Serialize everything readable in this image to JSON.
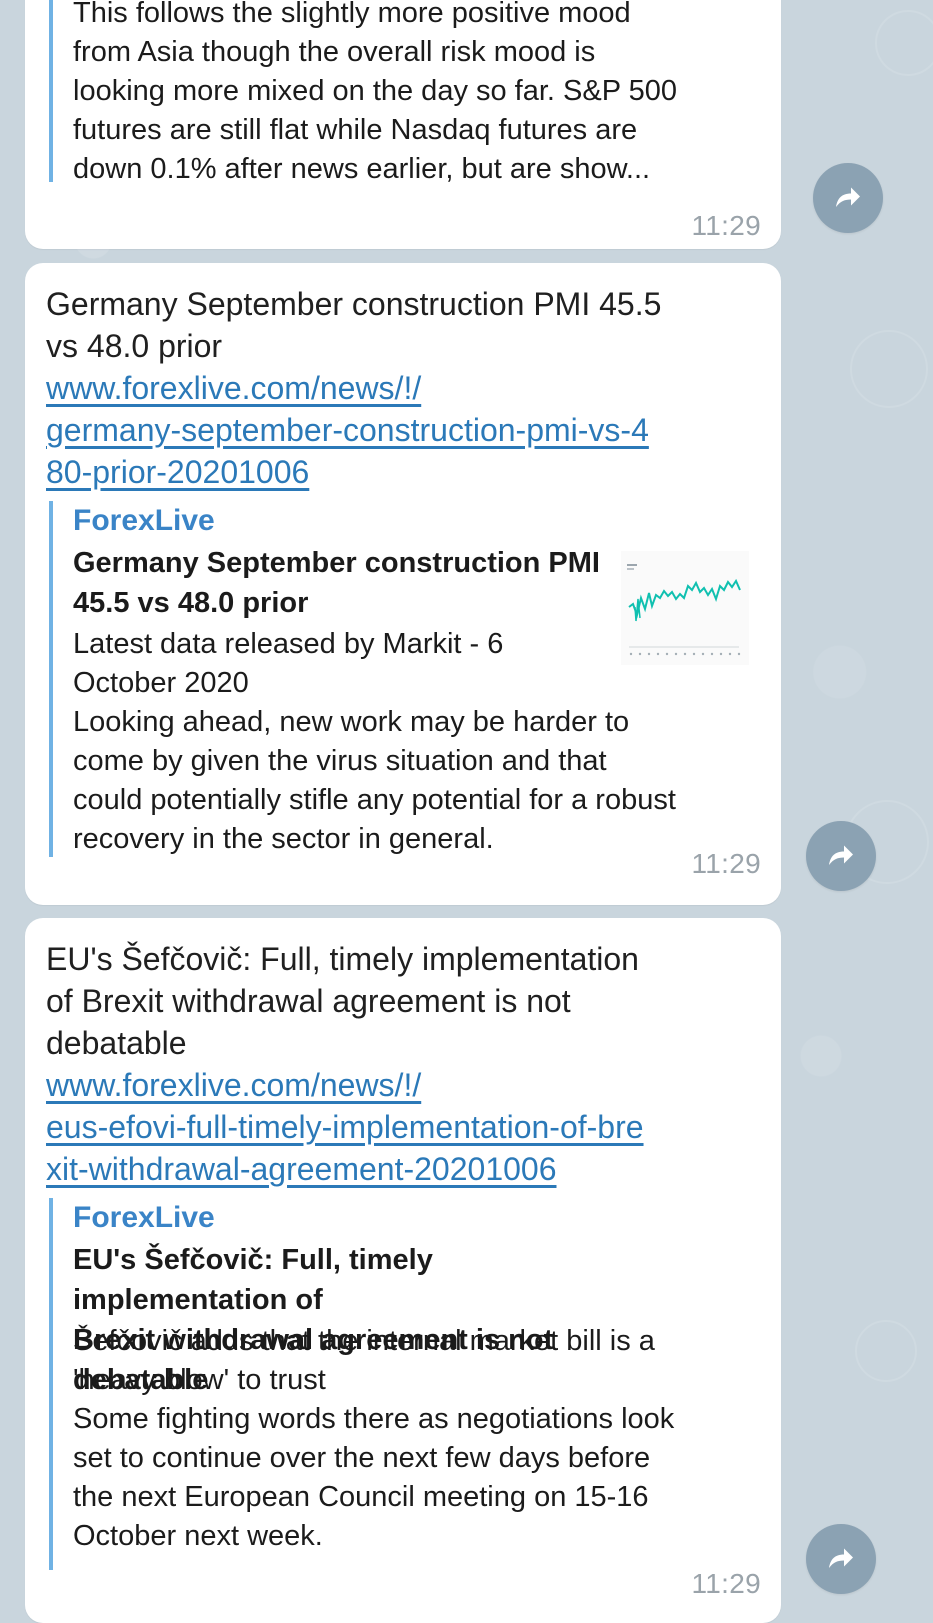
{
  "messages": [
    {
      "preview_body": "This follows the slightly more positive mood\nfrom Asia though the overall risk mood is\nlooking more mixed on the day so far. S&P 500\nfutures are still flat while Nasdaq futures are\ndown 0.1% after  news earlier, but are show...",
      "timestamp": "11:29",
      "share_icon": "share-arrow-icon"
    },
    {
      "headline": "Germany September construction PMI 45.5\nvs 48.0 prior",
      "link": "www.forexlive.com/news/!/\ngermany-september-construction-pmi-vs-4\n80-prior-20201006",
      "site_name": "ForexLive",
      "preview_title": "Germany September construction PMI\n45.5 vs 48.0 prior",
      "preview_body": "Latest data released by Markit - 6\nOctober 2020\nLooking ahead, new work may be harder to\ncome by given the virus situation and that\ncould potentially stifle any potential for a robust\nrecovery in the sector in general.",
      "timestamp": "11:29",
      "thumbnail_icon": "chart-thumbnail-icon",
      "share_icon": "share-arrow-icon"
    },
    {
      "headline": "EU's Šefčovič: Full, timely implementation\nof Brexit withdrawal agreement is not\ndebatable",
      "link": "www.forexlive.com/news/!/\neus-efovi-full-timely-implementation-of-bre\nxit-withdrawal-agreement-20201006",
      "site_name": "ForexLive",
      "preview_title": "EU's Šefčovič: Full, timely implementation of\nBrexit withdrawal agreement is not debatable",
      "preview_body": "Šefčovič adds that the internal market bill is a\n'heavy blow' to trust\nSome fighting words there as negotiations look\nset to continue over the next few days before\nthe next European Council meeting on 15-16\nOctober next week.",
      "timestamp": "11:29",
      "share_icon": "share-arrow-icon"
    }
  ],
  "colors": {
    "background": "#c9d5dd",
    "bubble": "#ffffff",
    "link": "#2b79b8",
    "accent": "#70b2e4",
    "timestamp": "#9aa3aa",
    "share_button": "#8ba2b3"
  }
}
